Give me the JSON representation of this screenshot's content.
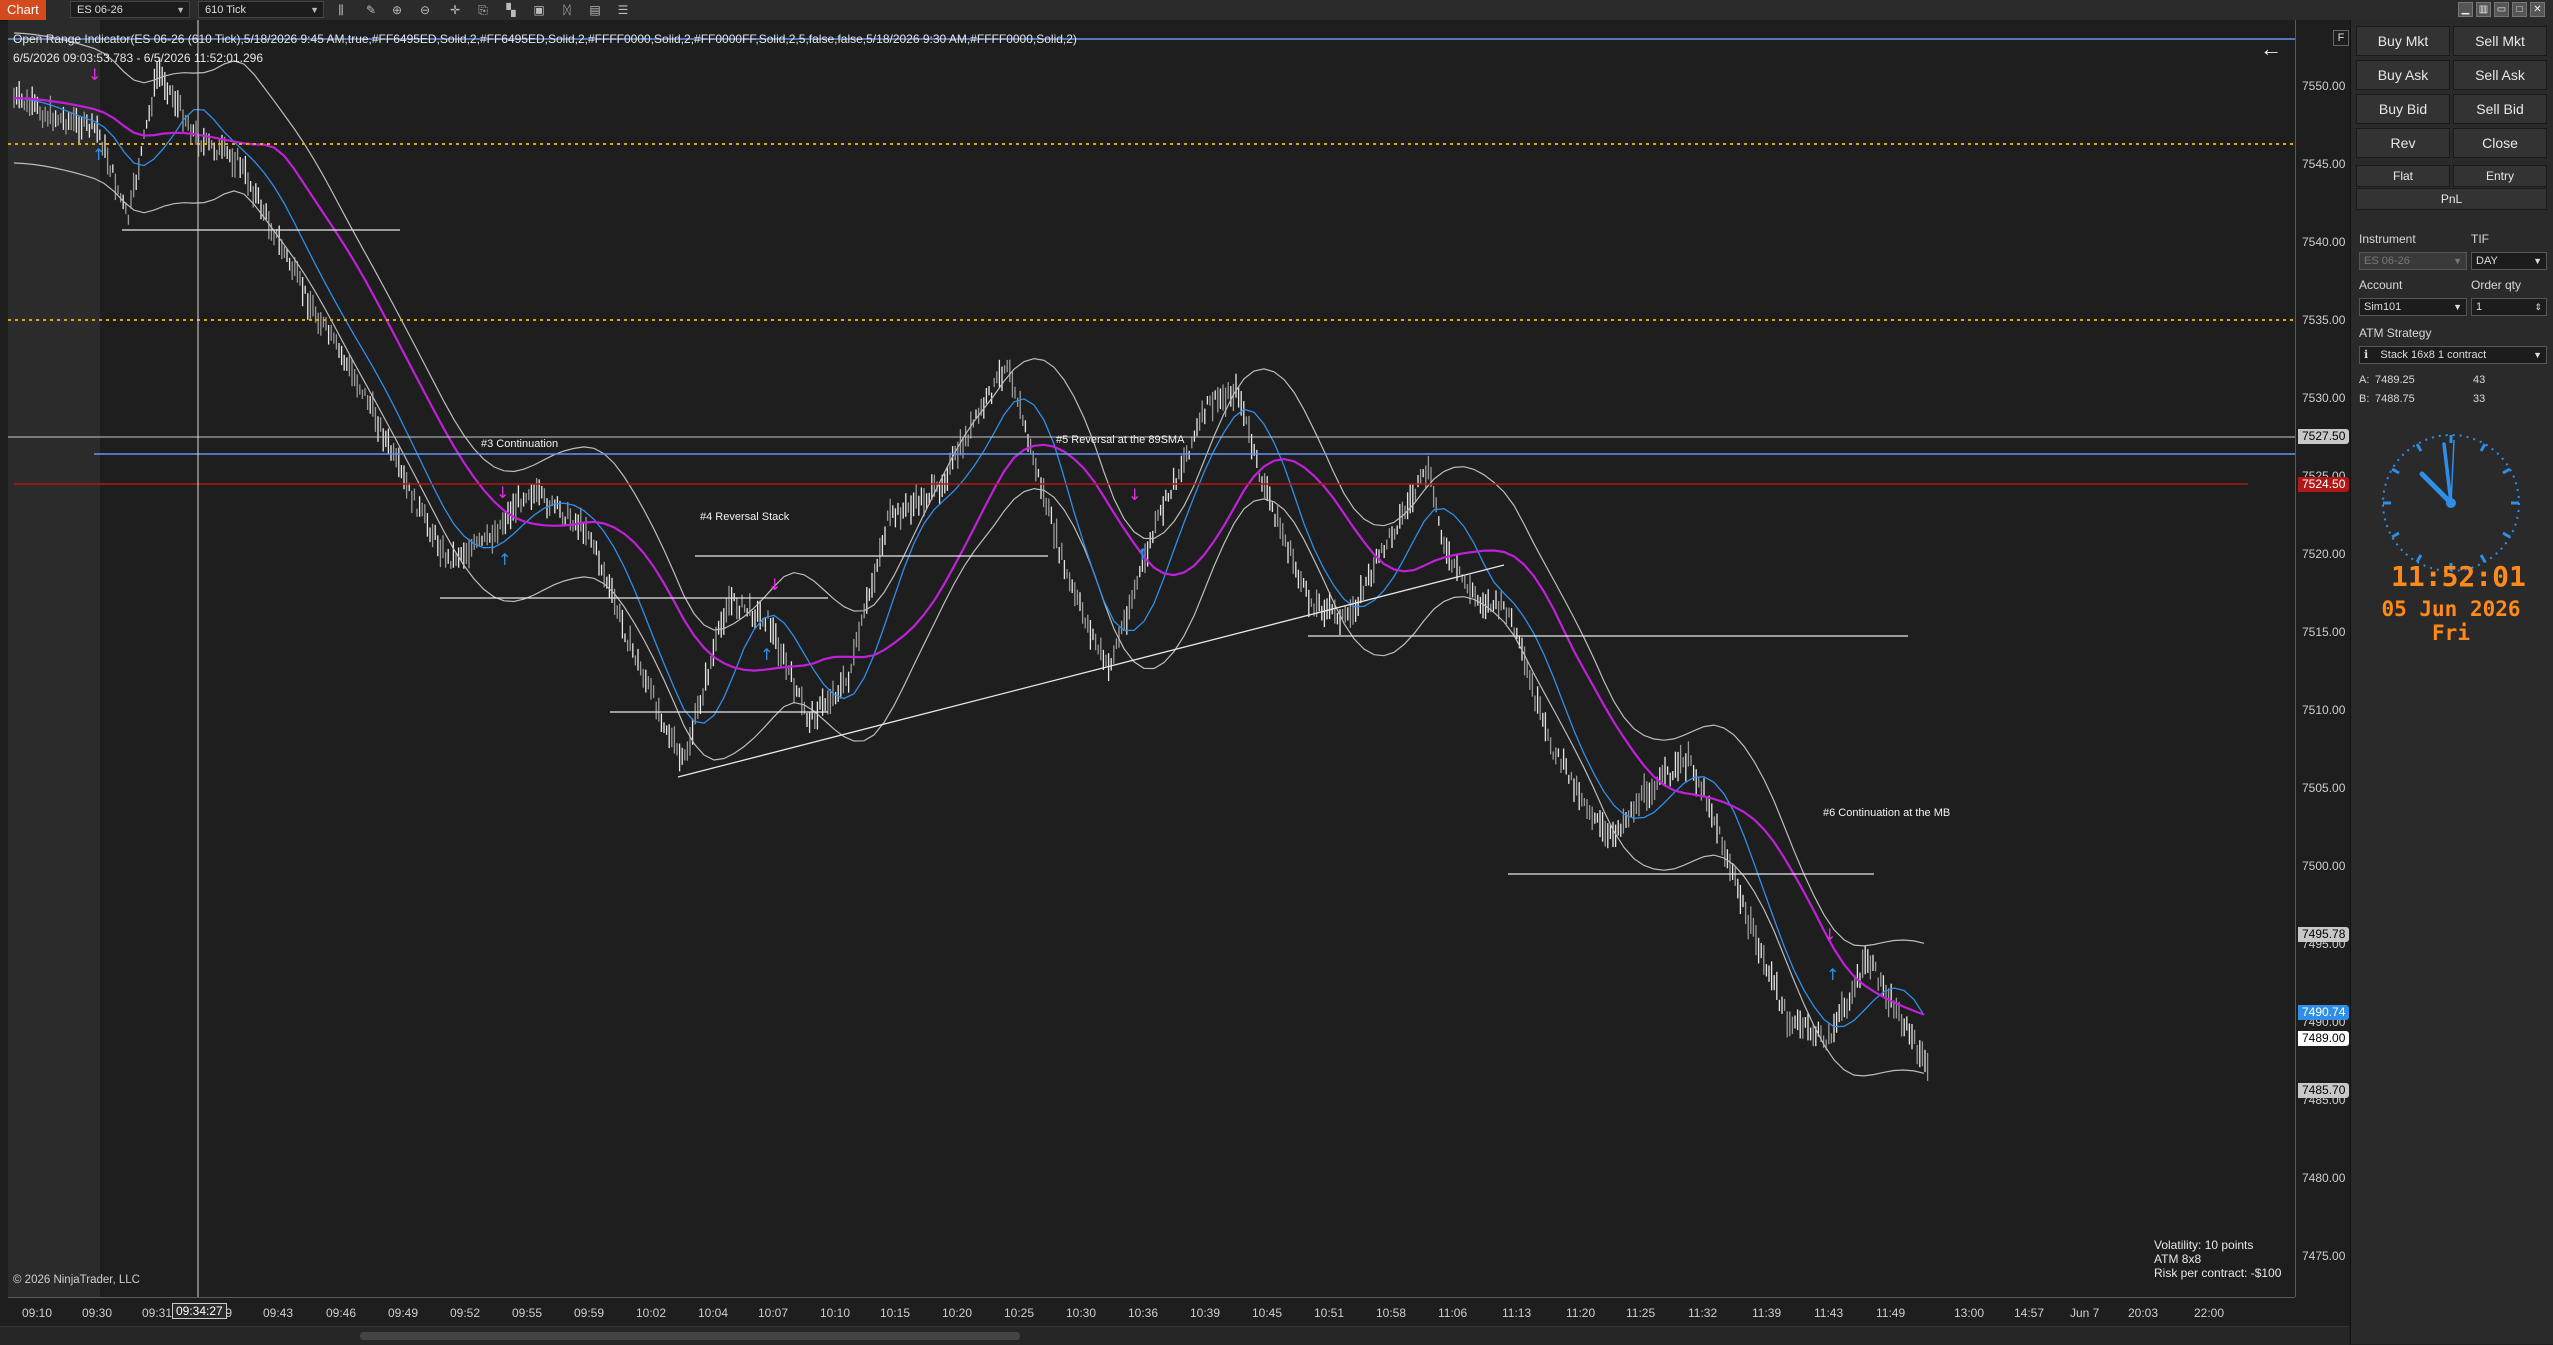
{
  "toolbar": {
    "chart_tab": "Chart",
    "instrument": "ES 06-26",
    "interval": "610 Tick"
  },
  "chart": {
    "indicator_line": "Open Range Indicator(ES 06-26 (610 Tick),5/18/2026 9:45 AM,true,#FF6495ED,Solid,2,#FF6495ED,Solid,2,#FFFF0000,Solid,2,#FF0000FF,Solid,2,5,false,false,5/18/2026 9:30 AM,#FFFF0000,Solid,2)",
    "date_range": "6/5/2026 09:03:53.783 - 6/5/2026 11:52:01.296",
    "copyright": "© 2026 NinjaTrader, LLC",
    "annotations": [
      {
        "text": "#3 Continuation"
      },
      {
        "text": "#4 Reversal Stack"
      },
      {
        "text": "#5 Reversal at the 89SMA"
      },
      {
        "text": "#6 Continuation at the MB"
      }
    ],
    "info": {
      "volatility": "Volatility: 10 points",
      "atm": "ATM 8x8",
      "risk": "Risk per contract: -$100"
    },
    "back_arrow": "←"
  },
  "price_axis": {
    "labels": [
      "7550.00",
      "7545.00",
      "7540.00",
      "7535.00",
      "7530.00",
      "7525.00",
      "7520.00",
      "7515.00",
      "7510.00",
      "7505.00",
      "7500.00",
      "7495.00",
      "7490.00",
      "7485.00",
      "7480.00",
      "7475.00"
    ],
    "tags": [
      {
        "text": "7527.50",
        "bg": "#c8c8c8",
        "fg": "#000000"
      },
      {
        "text": "7524.50",
        "bg": "#b01818",
        "fg": "#ffffff"
      },
      {
        "text": "7495.78",
        "bg": "#c8c8c8",
        "fg": "#000000"
      },
      {
        "text": "7490.74",
        "bg": "#2f8fe8",
        "fg": "#ffffff"
      },
      {
        "text": "7489.00",
        "bg": "#ffffff",
        "fg": "#000000"
      },
      {
        "text": "7485.70",
        "bg": "#c8c8c8",
        "fg": "#000000"
      }
    ],
    "f_button": "F"
  },
  "time_axis": {
    "labels": [
      "09:10",
      "09:30",
      "09:31",
      "09:39",
      "09:43",
      "09:46",
      "09:49",
      "09:52",
      "09:55",
      "09:59",
      "10:02",
      "10:04",
      "10:07",
      "10:10",
      "10:15",
      "10:20",
      "10:25",
      "10:30",
      "10:36",
      "10:39",
      "10:45",
      "10:51",
      "10:58",
      "11:06",
      "11:13",
      "11:20",
      "11:25",
      "11:32",
      "11:39",
      "11:43",
      "11:49",
      "13:00",
      "14:57",
      "Jun 7",
      "20:03",
      "22:00"
    ],
    "cursor_time": "09:34:27"
  },
  "order_panel": {
    "buttons": {
      "buy_mkt": "Buy Mkt",
      "sell_mkt": "Sell Mkt",
      "buy_ask": "Buy Ask",
      "sell_ask": "Sell Ask",
      "buy_bid": "Buy Bid",
      "sell_bid": "Sell Bid",
      "rev": "Rev",
      "close": "Close",
      "flat": "Flat",
      "entry": "Entry",
      "pnl": "PnL"
    },
    "instrument_label": "Instrument",
    "instrument_value": "ES 06-26",
    "tif_label": "TIF",
    "tif_value": "DAY",
    "account_label": "Account",
    "account_value": "Sim101",
    "order_qty_label": "Order qty",
    "order_qty_value": "1",
    "atm_label": "ATM Strategy",
    "atm_value": "Stack 16x8 1 contract",
    "ask_label": "A:",
    "ask_price": "7489.25",
    "ask_size": "43",
    "bid_label": "B:",
    "bid_price": "7488.75",
    "bid_size": "33",
    "clock_time": "11:52:01",
    "clock_date": "05 Jun 2026 Fri"
  },
  "colors": {
    "background": "#1e1e1e",
    "accent_orange": "#d4491e",
    "clock_color": "#2f8fe8",
    "clock_text": "#ff8a1c",
    "ema_magenta": "#c020d8",
    "ema_blue": "#2f8fe8",
    "open_range_gold": "#e0a800",
    "red_line": "#b01818"
  }
}
